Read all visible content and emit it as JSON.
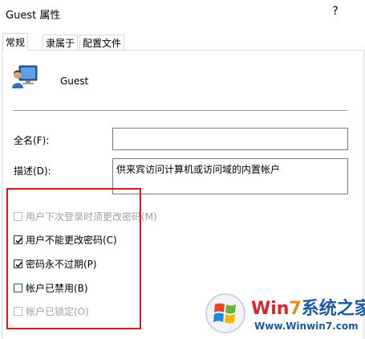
{
  "window": {
    "title": "Guest 属性",
    "help_label": "?"
  },
  "tabs": [
    {
      "label": "常规"
    },
    {
      "label": "隶属于"
    },
    {
      "label": "配置文件"
    }
  ],
  "user": {
    "name": "Guest"
  },
  "fields": {
    "fullname_label": "全名(F):",
    "fullname_value": "",
    "description_label": "描述(D):",
    "description_value": "供来宾访问计算机或访问域的内置帐户"
  },
  "options": [
    {
      "label": "用户下次登录时须更改密码(M)",
      "checked": false,
      "disabled": true
    },
    {
      "label": "用户不能更改密码(C)",
      "checked": true,
      "disabled": false
    },
    {
      "label": "密码永不过期(P)",
      "checked": true,
      "disabled": false
    },
    {
      "label": "帐户已禁用(B)",
      "checked": false,
      "disabled": false
    },
    {
      "label": "帐户已锁定(O)",
      "checked": false,
      "disabled": true
    }
  ],
  "watermark": {
    "title_part1": "Win",
    "title_part2": "7",
    "title_part3": "系统之家",
    "url": "Www.Winwin7.com"
  },
  "colors": {
    "highlight": "#e0141c",
    "checkbox_blue": "#1e5ca8",
    "disabled_text": "#a0a0a0"
  }
}
